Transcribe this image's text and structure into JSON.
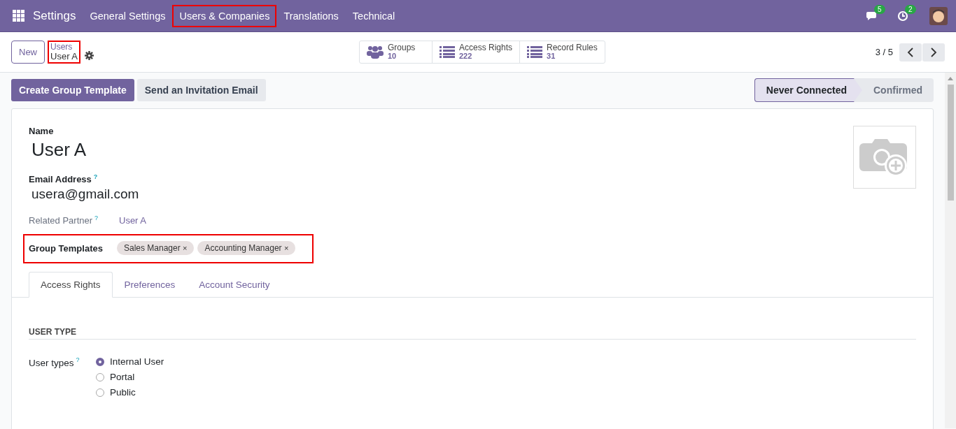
{
  "navbar": {
    "app": "Settings",
    "menu": [
      {
        "label": "General Settings",
        "highlighted": false
      },
      {
        "label": "Users & Companies",
        "highlighted": true
      },
      {
        "label": "Translations",
        "highlighted": false
      },
      {
        "label": "Technical",
        "highlighted": false
      }
    ],
    "messages_count": "5",
    "activities_count": "2"
  },
  "control_panel": {
    "new_button": "New",
    "breadcrumb": {
      "parent": "Users",
      "current": "User A",
      "highlighted": true
    },
    "smart_buttons": [
      {
        "kind": "groups",
        "label": "Groups",
        "value": "10"
      },
      {
        "kind": "list",
        "label": "Access Rights",
        "value": "222"
      },
      {
        "kind": "list",
        "label": "Record Rules",
        "value": "31"
      }
    ],
    "pager": "3 / 5"
  },
  "actions": [
    {
      "label": "Create Group Template",
      "primary": true
    },
    {
      "label": "Send an Invitation Email",
      "primary": false
    }
  ],
  "statusbar": [
    {
      "label": "Never Connected",
      "selected": true
    },
    {
      "label": "Confirmed",
      "selected": false
    }
  ],
  "form": {
    "name_label": "Name",
    "name": "User A",
    "email_label": "Email Address",
    "email_help": "?",
    "email": "usera@gmail.com",
    "partner_label": "Related Partner",
    "partner_help": "?",
    "partner": "User A",
    "group_templates": {
      "label": "Group Templates",
      "highlighted": true,
      "tags": [
        {
          "label": "Sales Manager",
          "remove": "×"
        },
        {
          "label": "Accounting Manager",
          "remove": "×"
        }
      ]
    },
    "tabs": [
      {
        "label": "Access Rights",
        "selected": true
      },
      {
        "label": "Preferences",
        "selected": false
      },
      {
        "label": "Account Security",
        "selected": false
      }
    ],
    "section_title": "USER TYPE",
    "user_types_label": "User types",
    "user_types_help": "?",
    "user_types": [
      {
        "label": "Internal User",
        "selected": true
      },
      {
        "label": "Portal",
        "selected": false
      },
      {
        "label": "Public",
        "selected": false
      }
    ]
  }
}
